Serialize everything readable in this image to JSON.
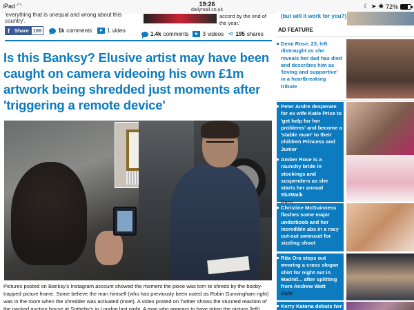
{
  "status_bar": {
    "device": "iPad",
    "wifi_icon": "wifi-icon",
    "time": "19:26",
    "url": "dailymail.co.uk",
    "battery": "72%",
    "battery_level": 0.72
  },
  "top_strip": {
    "quote_left": "'everything that is unequal and wrong about this country'.",
    "quote_right": "accord by the end of the year.'"
  },
  "share_left": {
    "share_label": "Share",
    "share_count": "189",
    "comments": "1k",
    "comments_label": "comments",
    "video_count": "1",
    "video_label": "video"
  },
  "share_right": {
    "comments": "1.4k",
    "comments_label": "comments",
    "video_count": "3",
    "video_label": "videos",
    "shares": "195",
    "shares_label": "shares"
  },
  "article": {
    "headline": "Is this Banksy? Elusive artist may have been caught on camera videoing his own £1m artwork being shredded just moments after 'triggering a remote device'",
    "caption": "Pictures posted on Banksy's Instagram account showed the moment the piece was torn to shreds by the booby-trapped picture frame. Some believe the man himself (who has previously been outed as Robin Gunningham right) was in the room when the shredder was activated (inset). A video posted on Twitter shows the stunned reaction of the packed auction house at Sotheby's in London last night. A man who appears to have taken the picture (left) posted online by"
  },
  "sidebar": {
    "top_tile": "(but will it work for you?)",
    "ad_feature": "AD FEATURE",
    "items": [
      {
        "title": "Demi Rose, 23, left distraught as she reveals her dad has died and describes him as 'loving and supportive' in a heartbreaking tribute",
        "sub": "",
        "style": "white"
      },
      {
        "title": "Peter Andre desperate for ex wife Katie Price to 'get help for her problems' and become a 'stable mum' to their children Princess and Junior",
        "sub": "",
        "style": "blue"
      },
      {
        "title": "Amber Rose is a raunchy bride in stockings and suspenders as she starts her annual SlutWalk",
        "sub": "Racy",
        "style": "blue"
      },
      {
        "title": "Christine McGuinness flashes some major underboob and her incredible abs in a racy cut-out swimsuit for sizzling shoot",
        "sub": "",
        "style": "blue"
      },
      {
        "title": "Rita Ora steps out wearing a crass slogan shirt for night out in Madrid... after splitting from Andrew Watt",
        "sub": "Style",
        "style": "blue"
      },
      {
        "title": "Kerry Katona debuts her newly PURPLE hair as she leaves meeting",
        "sub": "",
        "style": "blue"
      }
    ]
  },
  "colors": {
    "brand_blue": "#0c7bbf",
    "facebook": "#3b5998"
  }
}
